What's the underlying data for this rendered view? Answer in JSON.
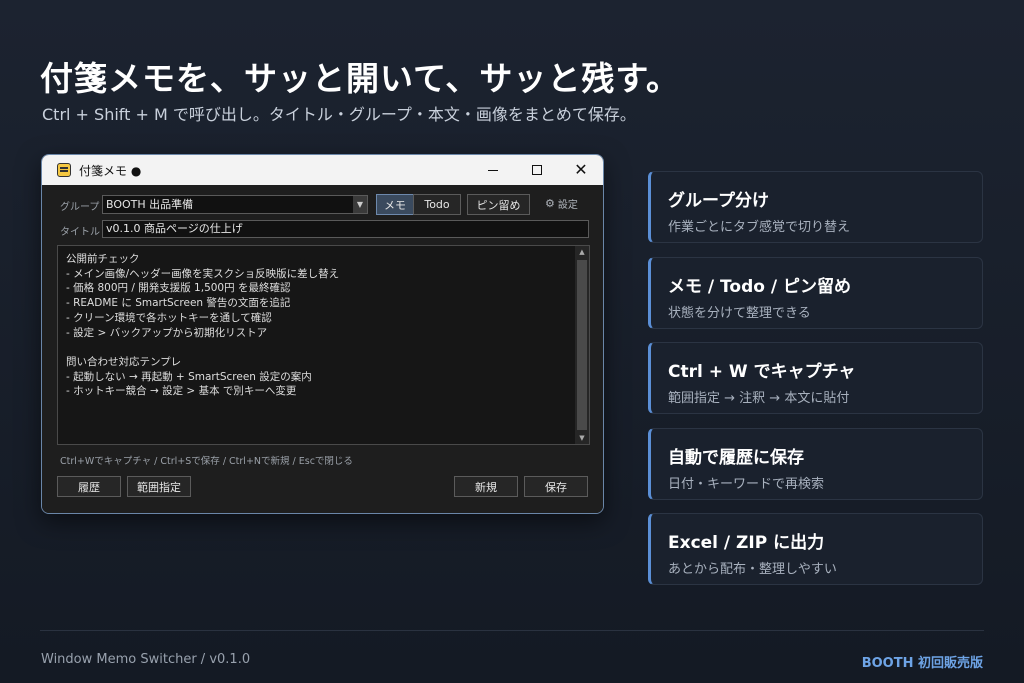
{
  "hero": {
    "headline": "付箋メモを、サッと開いて、サッと残す。",
    "subline": "Ctrl + Shift + M で呼び出し。タイトル・グループ・本文・画像をまとめて保存。"
  },
  "window": {
    "title": "付箋メモ ●",
    "icon": "sticky-note-icon",
    "group_label": "グループ",
    "group_value": "BOOTH 出品準備",
    "tabs": [
      "メモ",
      "Todo",
      "ピン留め"
    ],
    "active_tab": "メモ",
    "settings_label": "設定",
    "title_label": "タイトル",
    "title_value": "v0.1.0 商品ページの仕上げ",
    "body_lines": [
      "公開前チェック",
      "- メイン画像/ヘッダー画像を実スクショ反映版に差し替え",
      "- 価格 800円 / 開発支援版 1,500円 を最終確認",
      "- README に SmartScreen 警告の文面を追記",
      "- クリーン環境で各ホットキーを通して確認",
      "- 設定 > バックアップから初期化リストア",
      "",
      "問い合わせ対応テンプレ",
      "- 起動しない → 再起動 + SmartScreen 設定の案内",
      "- ホットキー競合 → 設定 > 基本 で別キーへ変更"
    ],
    "hint": "Ctrl+Wでキャプチャ / Ctrl+Sで保存 / Ctrl+Nで新規 / Escで閉じる",
    "buttons": {
      "history": "履歴",
      "range": "範囲指定",
      "new": "新規",
      "save": "保存"
    }
  },
  "features": [
    {
      "title": "グループ分け",
      "desc": "作業ごとにタブ感覚で切り替え"
    },
    {
      "title": "メモ / Todo / ピン留め",
      "desc": "状態を分けて整理できる"
    },
    {
      "title": "Ctrl + W でキャプチャ",
      "desc": "範囲指定 → 注釈 → 本文に貼付"
    },
    {
      "title": "自動で履歴に保存",
      "desc": "日付・キーワードで再検索"
    },
    {
      "title": "Excel / ZIP に出力",
      "desc": "あとから配布・整理しやすい"
    }
  ],
  "footer": {
    "left": "Window Memo Switcher / v0.1.0",
    "right": "BOOTH 初回販売版"
  },
  "colors": {
    "accent": "#5b8fd6",
    "brand": "#6ea4e6"
  }
}
